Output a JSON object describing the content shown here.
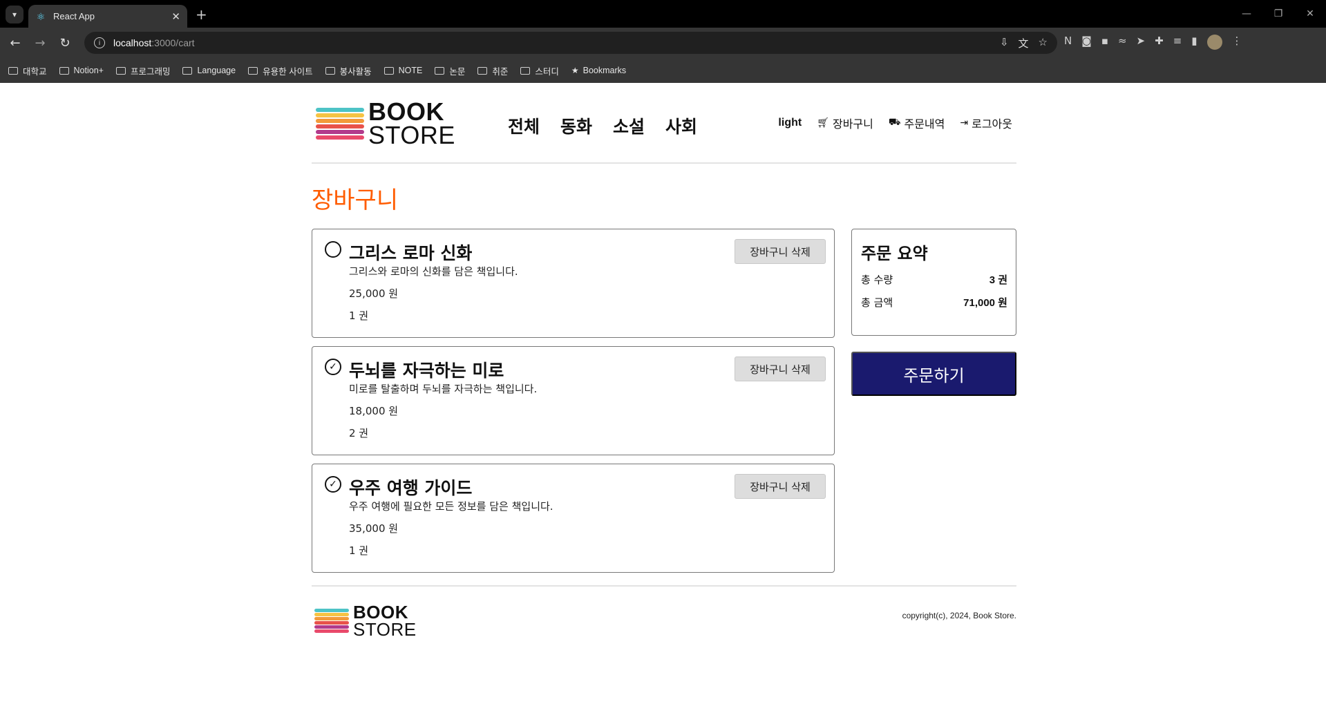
{
  "browser": {
    "tab_title": "React App",
    "url_host": "localhost",
    "url_path": ":3000/cart",
    "bookmarks": [
      {
        "label": "대학교",
        "icon": "folder-icon"
      },
      {
        "label": "Notion+",
        "icon": "folder-icon"
      },
      {
        "label": "프로그래밍",
        "icon": "folder-icon"
      },
      {
        "label": "Language",
        "icon": "folder-icon"
      },
      {
        "label": "유용한 사이트",
        "icon": "folder-icon"
      },
      {
        "label": "봉사활동",
        "icon": "folder-icon"
      },
      {
        "label": "NOTE",
        "icon": "folder-icon"
      },
      {
        "label": "논문",
        "icon": "folder-icon"
      },
      {
        "label": "취준",
        "icon": "folder-icon"
      },
      {
        "label": "스터디",
        "icon": "folder-icon"
      },
      {
        "label": "Bookmarks",
        "icon": "star-icon"
      }
    ]
  },
  "header": {
    "logo_line1": "BOOK",
    "logo_line2": "STORE",
    "categories": [
      "전체",
      "동화",
      "소설",
      "사회"
    ],
    "theme_label": "light",
    "cart_label": "장바구니",
    "orders_label": "주문내역",
    "logout_label": "로그아웃"
  },
  "cart": {
    "title": "장바구니",
    "items": [
      {
        "title": "그리스 로마 신화",
        "summary": "그리스와 로마의 신화를 담은 책입니다.",
        "price": "25,000 원",
        "quantity": "1 권",
        "checked": false,
        "delete_label": "장바구니 삭제"
      },
      {
        "title": "두뇌를 자극하는 미로",
        "summary": "미로를 탈출하며 두뇌를 자극하는 책입니다.",
        "price": "18,000 원",
        "quantity": "2 권",
        "checked": true,
        "delete_label": "장바구니 삭제"
      },
      {
        "title": "우주 여행 가이드",
        "summary": "우주 여행에 필요한 모든 정보를 담은 책입니다.",
        "price": "35,000 원",
        "quantity": "1 권",
        "checked": true,
        "delete_label": "장바구니 삭제"
      }
    ]
  },
  "summary": {
    "title": "주문 요약",
    "qty_label": "총 수량",
    "qty_value": "3 권",
    "price_label": "총 금액",
    "price_value": "71,000 원",
    "order_button": "주문하기"
  },
  "footer": {
    "logo_line1": "BOOK",
    "logo_line2": "STORE",
    "copyright": "copyright(c), 2024, Book Store."
  },
  "colors": {
    "accent_title": "#ff5c00",
    "order_button": "#1a1a6e",
    "logo_bars": [
      "#4dc3c6",
      "#f6c343",
      "#f29a3a",
      "#e8524a",
      "#b23a8c",
      "#e94a6b"
    ]
  }
}
